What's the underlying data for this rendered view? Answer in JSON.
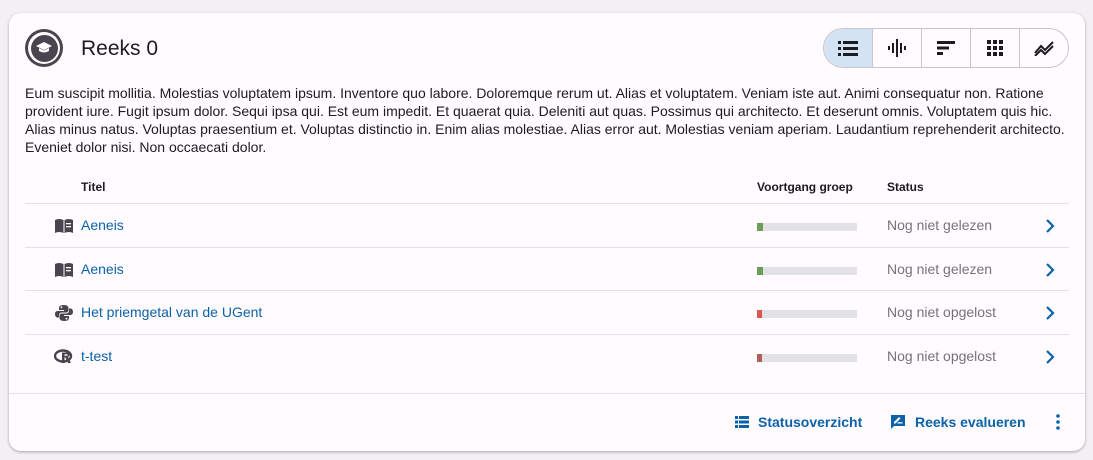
{
  "series": {
    "title": "Reeks 0",
    "description": "Eum suscipit mollitia. Molestias voluptatem ipsum. Inventore quo labore. Doloremque rerum ut. Alias et voluptatem. Veniam iste aut. Animi consequatur non. Ratione provident iure. Fugit ipsum dolor. Sequi ipsa qui. Est eum impedit. Et quaerat quia. Deleniti aut quas. Possimus qui architecto. Et deserunt omnis. Voluptatem quis hic. Alias minus natus. Voluptas praesentium et. Voluptas distinctio in. Enim alias molestiae. Alias error aut. Molestias veniam aperiam. Laudantium reprehenderit architecto. Eveniet dolor nisi. Non occaecati dolor."
  },
  "view_toggle": {
    "buttons": [
      {
        "icon": "list-icon",
        "active": true
      },
      {
        "icon": "waveform-icon",
        "active": false
      },
      {
        "icon": "sort-bars-icon",
        "active": false
      },
      {
        "icon": "grid-icon",
        "active": false
      },
      {
        "icon": "trend-lines-icon",
        "active": false
      }
    ]
  },
  "table": {
    "headers": {
      "title": "Titel",
      "progress": "Voortgang groep",
      "status": "Status"
    },
    "rows": [
      {
        "icon": "book-icon",
        "title": "Aeneis",
        "status": "Nog niet gelezen",
        "progress": 0.06,
        "progress_color": "#6a9e5a"
      },
      {
        "icon": "book-icon",
        "title": "Aeneis",
        "status": "Nog niet gelezen",
        "progress": 0.06,
        "progress_color": "#6a9e5a"
      },
      {
        "icon": "python-icon",
        "title": "Het priemgetal van de UGent",
        "status": "Nog niet opgelost",
        "progress": 0.05,
        "progress_color": "#d9584e"
      },
      {
        "icon": "r-language-icon",
        "title": "t-test",
        "status": "Nog niet opgelost",
        "progress": 0.05,
        "progress_color": "#b0605a"
      }
    ]
  },
  "footer": {
    "status_overview_label": "Statusoverzicht",
    "evaluate_label": "Reeks evalueren"
  },
  "colors": {
    "accent": "#0a63a8",
    "toggle_active": "#d3e3f3"
  }
}
